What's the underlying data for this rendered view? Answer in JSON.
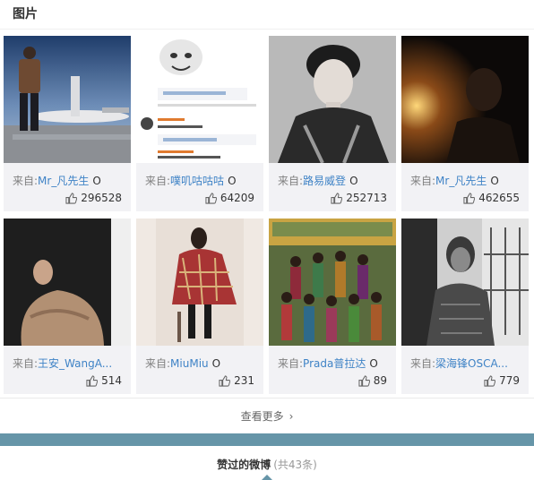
{
  "section": {
    "title": "图片"
  },
  "cards": [
    {
      "source_prefix": "来自:",
      "author": "Mr_凡先生",
      "badge": "O",
      "likes": "296528",
      "image": "man-standing-beside-airplane-photo"
    },
    {
      "source_prefix": "来自:",
      "author": "噗叽咕咕咕",
      "badge": "O",
      "likes": "64209",
      "image": "meme-screenshot-photo"
    },
    {
      "source_prefix": "来自:",
      "author": "路易威登",
      "badge": "O",
      "likes": "252713",
      "image": "black-white-portrait-photo"
    },
    {
      "source_prefix": "来自:",
      "author": "Mr_凡先生",
      "badge": "O",
      "likes": "462655",
      "image": "dark-lamp-portrait-photo"
    },
    {
      "source_prefix": "来自:",
      "author": "王安_WangA...",
      "badge": "",
      "likes": "514",
      "image": "woman-in-ruffled-dress-photo"
    },
    {
      "source_prefix": "来自:",
      "author": "MiuMiu",
      "badge": "O",
      "likes": "231",
      "image": "model-in-plaid-coat-photo"
    },
    {
      "source_prefix": "来自:",
      "author": "Prada普拉达",
      "badge": "O",
      "likes": "89",
      "image": "magazine-cover-group-photo"
    },
    {
      "source_prefix": "来自:",
      "author": "梁海锋OSCA...",
      "badge": "",
      "likes": "779",
      "image": "woman-in-cheongsam-photo"
    }
  ],
  "more": {
    "label": "查看更多"
  },
  "liked_weibo": {
    "label": "赞过的微博",
    "count": "(共43条)"
  },
  "colors": {
    "accent_link": "#3f83c6",
    "bar": "#6695a8",
    "card_bg": "#f2f2f5"
  }
}
